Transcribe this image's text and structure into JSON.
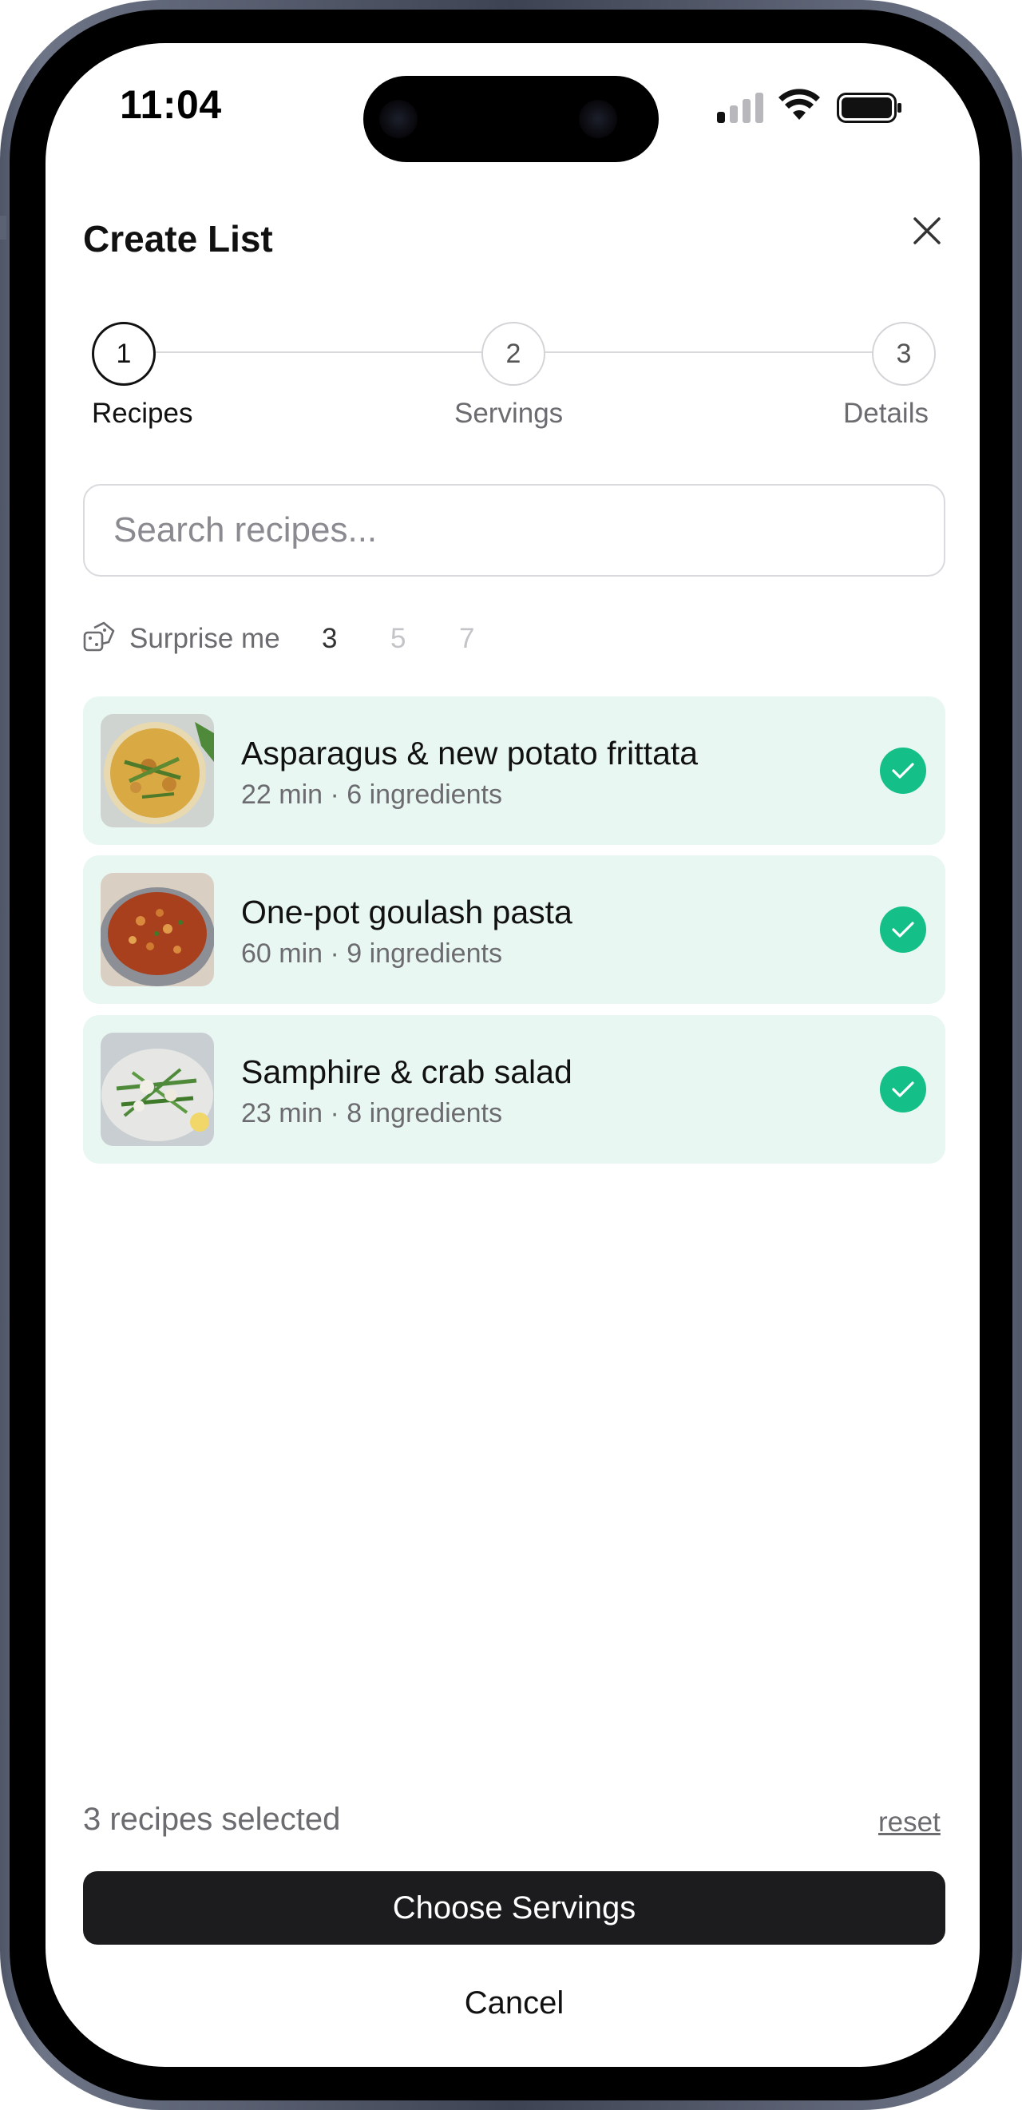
{
  "status_bar": {
    "time": "11:04"
  },
  "header": {
    "title": "Create List",
    "close_icon": "close-icon"
  },
  "stepper": {
    "steps": [
      {
        "number": "1",
        "label": "Recipes",
        "active": true
      },
      {
        "number": "2",
        "label": "Servings",
        "active": false
      },
      {
        "number": "3",
        "label": "Details",
        "active": false
      }
    ]
  },
  "search": {
    "placeholder": "Search recipes..."
  },
  "surprise": {
    "label": "Surprise me",
    "icon": "dice-icon",
    "options": [
      "3",
      "5",
      "7"
    ],
    "selected": "3"
  },
  "recipes": [
    {
      "title": "Asparagus & new potato frittata",
      "meta": "22 min · 6 ingredients",
      "selected": true
    },
    {
      "title": "One-pot goulash pasta",
      "meta": "60 min · 9 ingredients",
      "selected": true
    },
    {
      "title": "Samphire & crab salad",
      "meta": "23 min · 8 ingredients",
      "selected": true
    }
  ],
  "footer": {
    "selected_count": "3 recipes selected",
    "reset_label": "reset",
    "primary_label": "Choose Servings",
    "cancel_label": "Cancel"
  },
  "colors": {
    "accent_green": "#14c088",
    "card_bg": "#e8f7f1",
    "primary_button": "#1c1c1e"
  }
}
